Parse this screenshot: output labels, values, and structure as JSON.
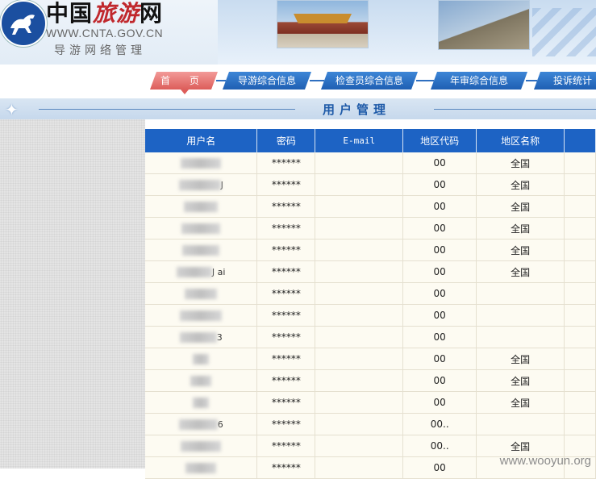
{
  "header": {
    "site_name_prefix": "中国",
    "site_name_accent": "旅游",
    "site_name_suffix": "网",
    "site_url": "WWW.CNTA.GOV.CN",
    "subtitle": "导游网络管理"
  },
  "nav": {
    "tabs": [
      {
        "label": "首 页",
        "active": true
      },
      {
        "label": "导游综合信息",
        "active": false
      },
      {
        "label": "检查员综合信息",
        "active": false
      },
      {
        "label": "年审综合信息",
        "active": false
      },
      {
        "label": "投诉统计",
        "active": false
      }
    ]
  },
  "page": {
    "title": "用户管理"
  },
  "table": {
    "headers": [
      "用户名",
      "密码",
      "E-mail",
      "地区代码",
      "地区名称"
    ],
    "rows": [
      {
        "username": "",
        "password": "******",
        "email": "",
        "code": "00",
        "region": "全国"
      },
      {
        "username": "J",
        "password": "******",
        "email": "",
        "code": "00",
        "region": "全国"
      },
      {
        "username": "",
        "password": "******",
        "email": "",
        "code": "00",
        "region": "全国"
      },
      {
        "username": "",
        "password": "******",
        "email": "",
        "code": "00",
        "region": "全国"
      },
      {
        "username": "",
        "password": "******",
        "email": "",
        "code": "00",
        "region": "全国"
      },
      {
        "username": "J    ai",
        "password": "******",
        "email": "",
        "code": "00",
        "region": "全国"
      },
      {
        "username": "",
        "password": "******",
        "email": "",
        "code": "00",
        "region": ""
      },
      {
        "username": "",
        "password": "******",
        "email": "",
        "code": "00",
        "region": ""
      },
      {
        "username": "3",
        "password": "******",
        "email": "",
        "code": "00",
        "region": ""
      },
      {
        "username": "",
        "password": "******",
        "email": "",
        "code": "00",
        "region": "全国"
      },
      {
        "username": "",
        "password": "******",
        "email": "",
        "code": "00",
        "region": "全国"
      },
      {
        "username": "",
        "password": "******",
        "email": "",
        "code": "00",
        "region": "全国"
      },
      {
        "username": "6",
        "password": "******",
        "email": "",
        "code": "00..",
        "region": ""
      },
      {
        "username": "",
        "password": "******",
        "email": "",
        "code": "00..",
        "region": "全国"
      },
      {
        "username": "",
        "password": "******",
        "email": "",
        "code": "00",
        "region": ""
      }
    ]
  },
  "watermark": "www.wooyun.org",
  "colors": {
    "header_blue": "#1d63c4",
    "tab_active": "#dd5d5a",
    "row_bg": "#fdfbf2",
    "title_text": "#1e5aa8"
  }
}
